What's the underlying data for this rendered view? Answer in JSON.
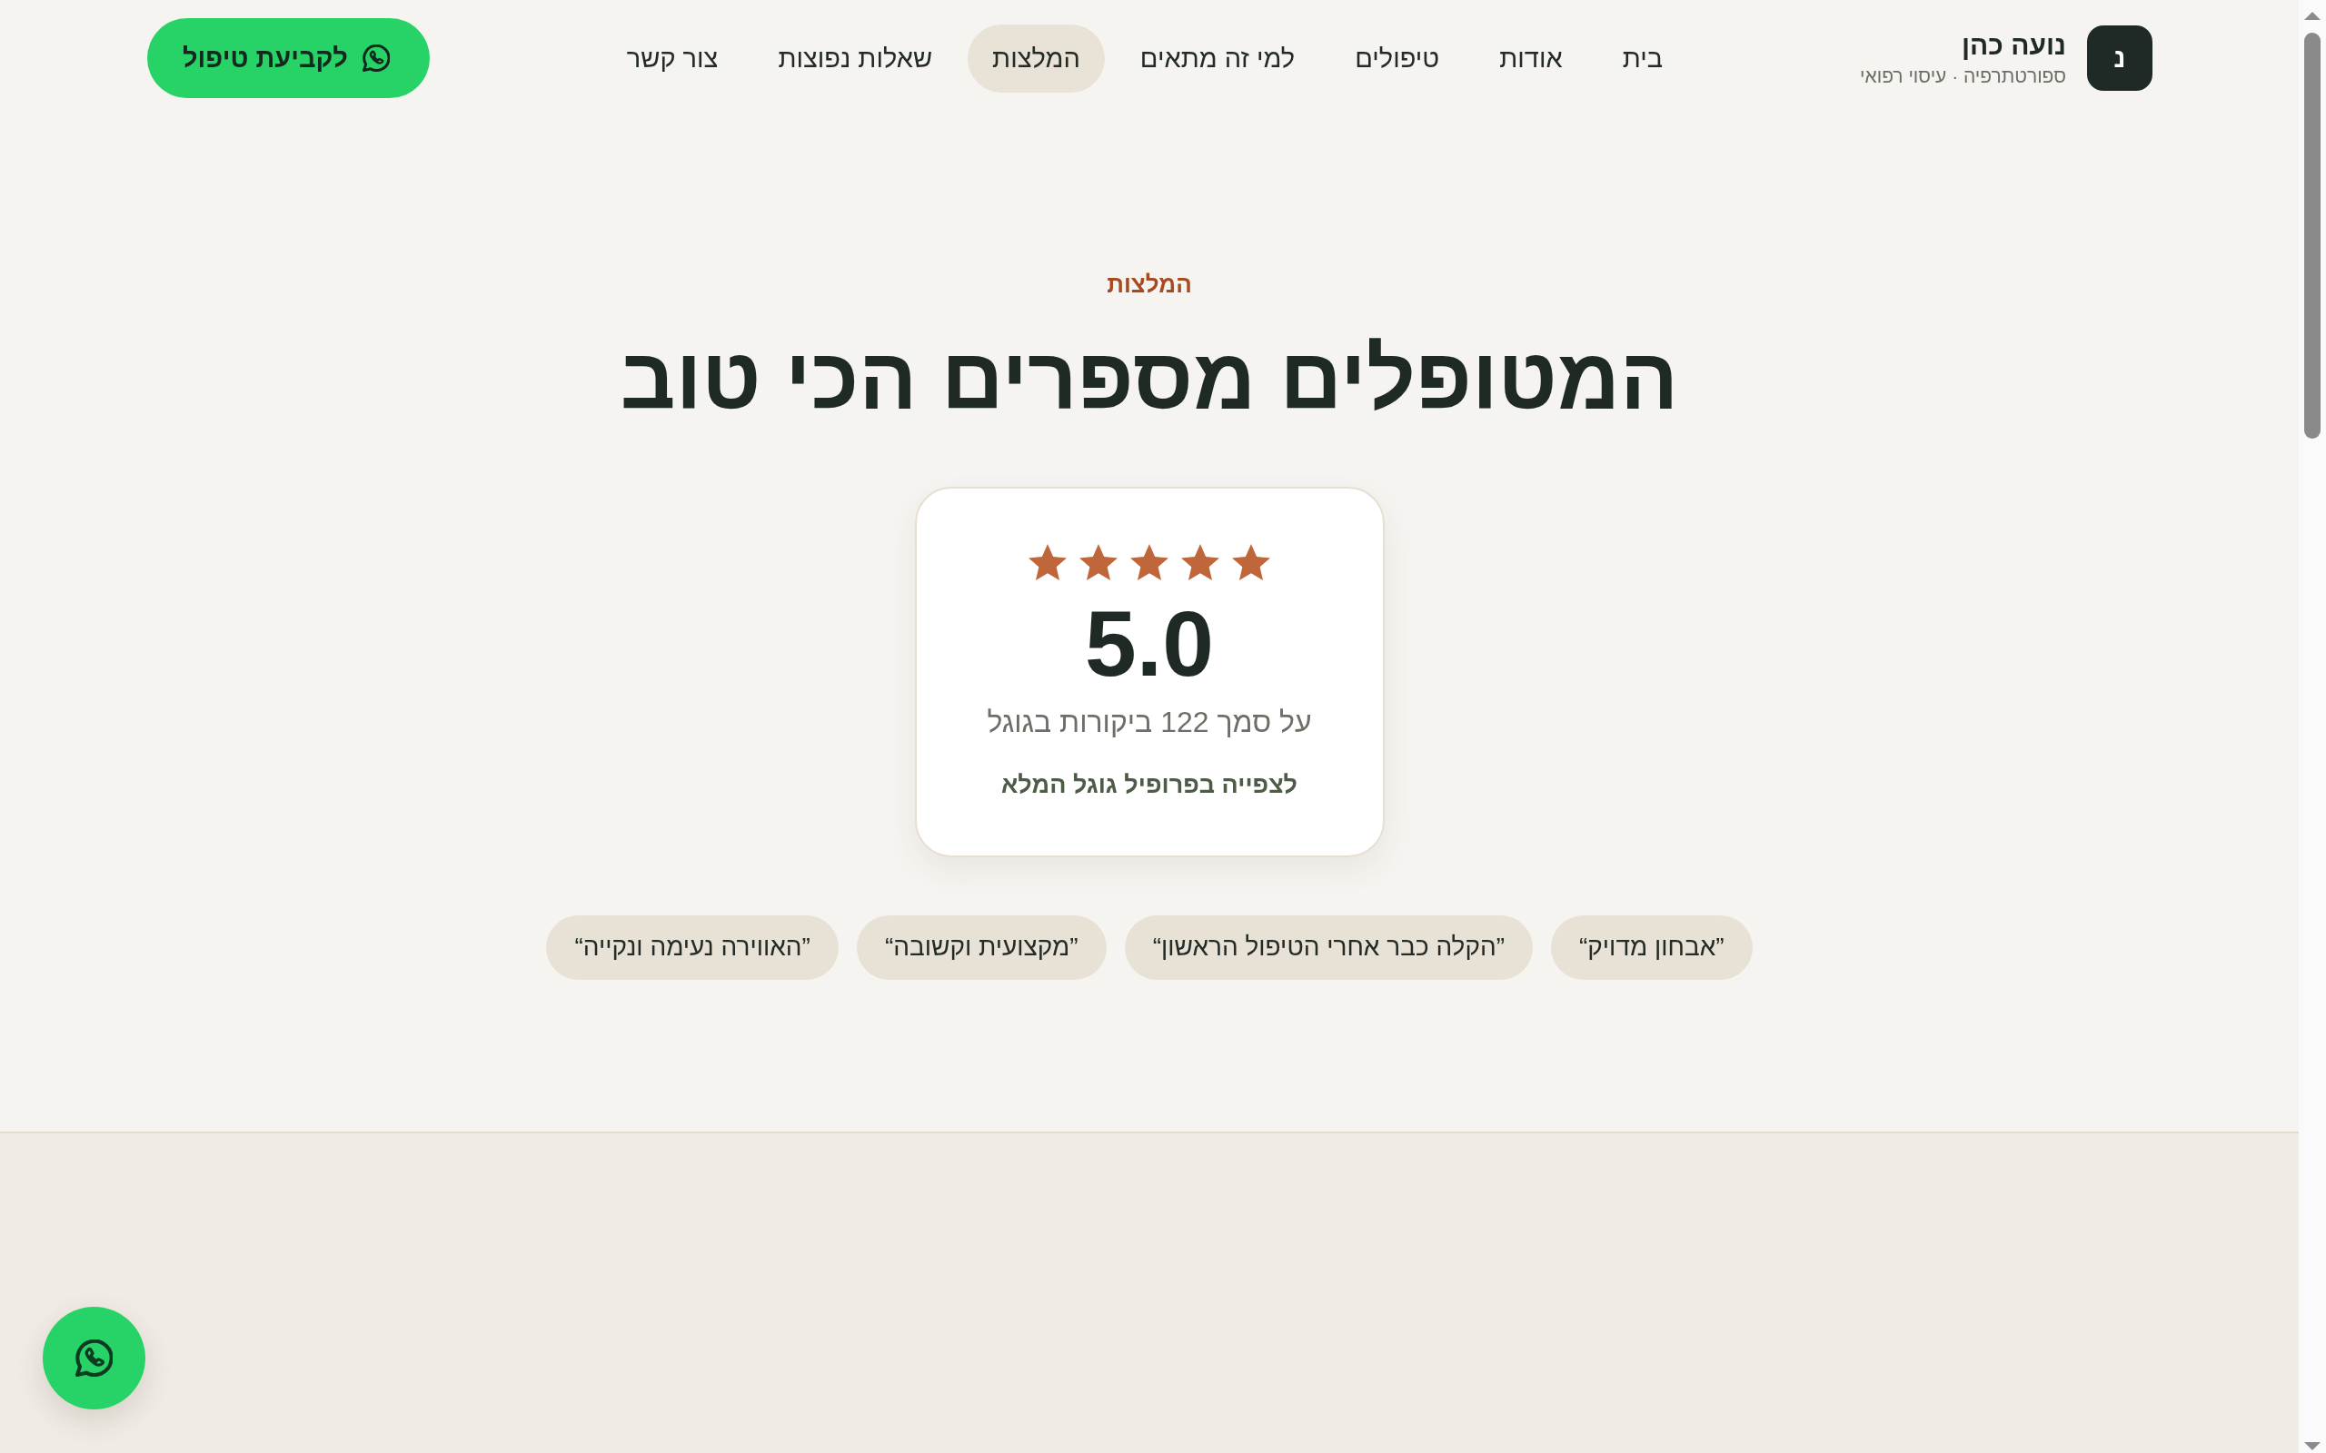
{
  "header": {
    "logo": {
      "letter": "נ",
      "name": "נועה כהן",
      "tagline": "ספורטתרפיה · עיסוי רפואי"
    },
    "nav": [
      {
        "label": "בית",
        "selected": false
      },
      {
        "label": "אודות",
        "selected": false
      },
      {
        "label": "טיפולים",
        "selected": false
      },
      {
        "label": "למי זה מתאים",
        "selected": false
      },
      {
        "label": "המלצות",
        "selected": true
      },
      {
        "label": "שאלות נפוצות",
        "selected": false
      },
      {
        "label": "צור קשר",
        "selected": false
      }
    ],
    "cta": {
      "label": "לקביעת טיפול"
    }
  },
  "testimonials": {
    "eyebrow": "המלצות",
    "title": "המטופלים מספרים הכי טוב",
    "rating_card": {
      "stars": 5,
      "score": "5.0",
      "caption": "על סמך 122 ביקורות בגוגל",
      "link": "לצפייה בפרופיל גוגל המלא"
    },
    "quotes": [
      "”אבחון מדויק“",
      "”הקלה כבר אחרי הטיפול הראשון“",
      "”מקצועית וקשובה“",
      "”האווירה נעימה ונקייה“"
    ]
  }
}
